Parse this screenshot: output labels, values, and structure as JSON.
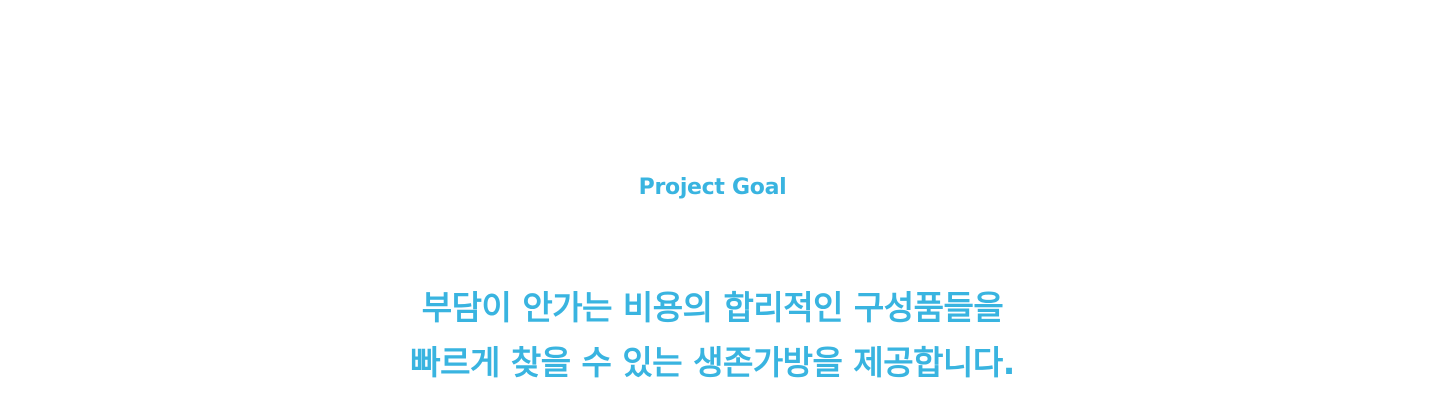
{
  "goal_section": {
    "label": "Project Goal",
    "statement_lines": [
      "부담이 안가는 비용의 합리적인 구성품들을",
      "빠르게 찾을 수 있는 생존가방을 제공합니다."
    ]
  },
  "colors": {
    "accent": "#39b4e0",
    "background": "#ffffff"
  }
}
